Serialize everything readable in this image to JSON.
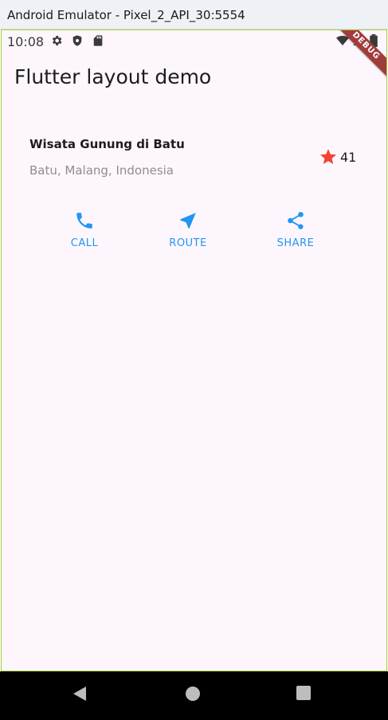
{
  "window": {
    "title": "Android Emulator - Pixel_2_API_30:5554"
  },
  "status_bar": {
    "time": "10:08",
    "icons": [
      "settings-icon",
      "shield-icon",
      "sd-card-icon",
      "wifi-icon",
      "signal-icon",
      "battery-icon"
    ],
    "debug_banner": "DEBUG"
  },
  "app_bar": {
    "title": "Flutter layout demo"
  },
  "place": {
    "title": "Wisata Gunung di Batu",
    "location": "Batu, Malang, Indonesia",
    "rating_icon": "star-icon",
    "rating_count": "41"
  },
  "actions": [
    {
      "label": "CALL",
      "icon": "phone-icon"
    },
    {
      "label": "ROUTE",
      "icon": "near-me-icon"
    },
    {
      "label": "SHARE",
      "icon": "share-icon"
    }
  ],
  "nav_bar": {
    "buttons": [
      "back-icon",
      "home-icon",
      "recents-icon"
    ]
  },
  "colors": {
    "accent": "#2196f3",
    "star": "#f44336",
    "screen_bg": "#fdf7fd",
    "nav_bg": "#000000"
  }
}
